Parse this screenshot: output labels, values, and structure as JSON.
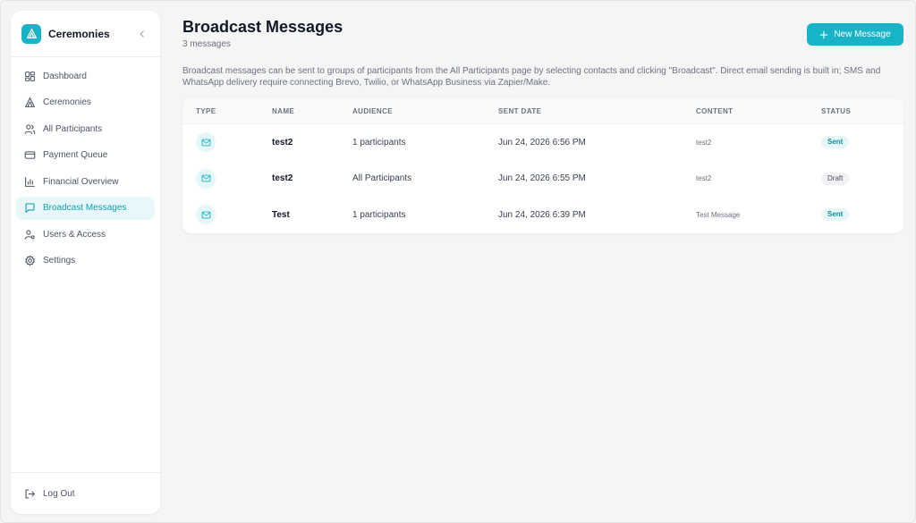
{
  "sidebar": {
    "brand": "Ceremonies",
    "items": [
      {
        "label": "Dashboard",
        "icon": "dashboard-icon"
      },
      {
        "label": "Ceremonies",
        "icon": "tent-icon"
      },
      {
        "label": "All Participants",
        "icon": "users-icon"
      },
      {
        "label": "Payment Queue",
        "icon": "credit-card-icon"
      },
      {
        "label": "Financial Overview",
        "icon": "bar-chart-icon"
      },
      {
        "label": "Broadcast Messages",
        "icon": "message-icon",
        "active": true
      },
      {
        "label": "Users & Access",
        "icon": "user-key-icon"
      },
      {
        "label": "Settings",
        "icon": "gear-icon"
      }
    ],
    "logout": "Log Out"
  },
  "header": {
    "title": "Broadcast Messages",
    "subtitle": "3 messages",
    "new_button": "New Message"
  },
  "description": "Broadcast messages can be sent to groups of participants from the All Participants page by selecting contacts and clicking \"Broadcast\". Direct email sending is built in; SMS and WhatsApp delivery require connecting Brevo, Twilio, or WhatsApp Business via Zapier/Make.",
  "table": {
    "columns": [
      "TYPE",
      "NAME",
      "AUDIENCE",
      "SENT DATE",
      "CONTENT",
      "STATUS"
    ],
    "rows": [
      {
        "type": "mail-icon",
        "name": "test2",
        "audience": "1 participants",
        "sent_date": "Jun 24, 2026 6:56 PM",
        "content": "test2",
        "status": "Sent"
      },
      {
        "type": "mail-icon",
        "name": "test2",
        "audience": "All Participants",
        "sent_date": "Jun 24, 2026 6:55 PM",
        "content": "test2",
        "status": "Draft"
      },
      {
        "type": "mail-icon",
        "name": "Test",
        "audience": "1 participants",
        "sent_date": "Jun 24, 2026 6:39 PM",
        "content": "Test Message",
        "status": "Sent"
      }
    ]
  },
  "colors": {
    "accent": "#17b3c6",
    "active_bg": "#e8f8fa",
    "sent_badge": "#e7f7f9",
    "draft_badge": "#f1f1f3"
  }
}
